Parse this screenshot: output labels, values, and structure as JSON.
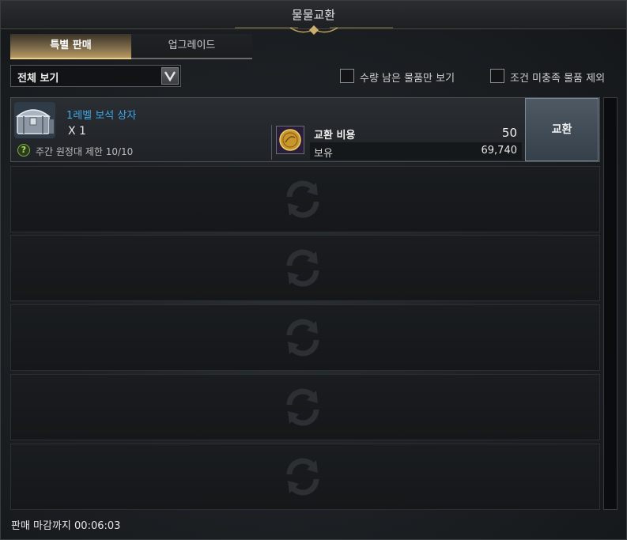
{
  "window": {
    "title": "물물교환"
  },
  "tabs": [
    {
      "label": "특별 판매",
      "active": true
    },
    {
      "label": "업그레이드",
      "active": false
    }
  ],
  "filter": {
    "selected": "전체 보기"
  },
  "checkboxes": [
    {
      "label": "수량 남은 물품만 보기",
      "checked": false
    },
    {
      "label": "조건 미충족 물품 제외",
      "checked": false
    }
  ],
  "items": [
    {
      "name": "1레벨 보석 상자",
      "quantity": "X 1",
      "limit_text": "주간 원정대 제한 10/10",
      "limit_icon_glyph": "?",
      "cost_label": "교환 비용",
      "cost_value": "50",
      "owned_label": "보유",
      "owned_value": "69,740",
      "button_label": "교환",
      "icon": "jewel-chest-icon",
      "currency_icon": "gold-coin-icon"
    }
  ],
  "empty_slot_icon": "exchange-arrows-icon",
  "footer": {
    "deadline": "판매 마감까지 00:06:03"
  },
  "colors": {
    "item_name": "#3fa9e8",
    "tab_active_accent": "#e8cf8e",
    "limit_icon": "#7ab03a"
  }
}
